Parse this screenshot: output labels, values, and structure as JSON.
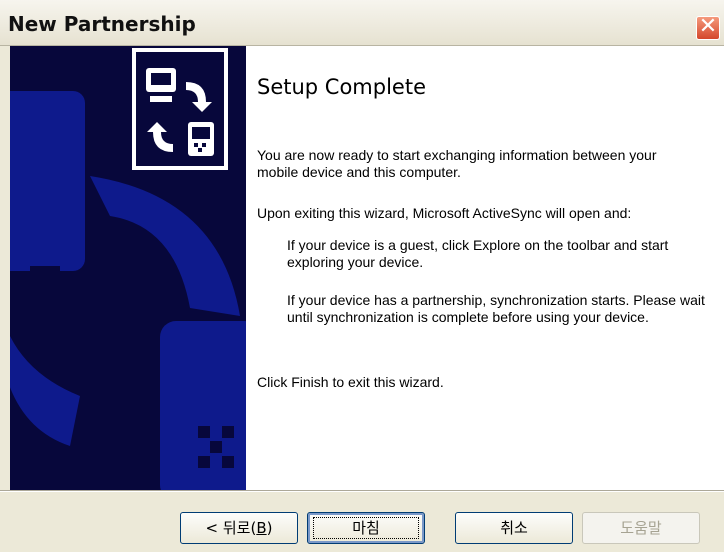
{
  "window": {
    "title": "New Partnership",
    "close_glyph": "✕"
  },
  "content": {
    "heading": "Setup Complete",
    "paragraphs": [
      "You are now ready to start exchanging information between your mobile device and this computer.",
      "Upon exiting this wizard, Microsoft ActiveSync will open and:",
      "If your device is a guest, click Explore on the toolbar and start exploring your device.",
      "If your device has a partnership, synchronization starts. Please wait until synchronization is complete before using your device.",
      "Click Finish to exit this wizard."
    ]
  },
  "buttons": {
    "back_prefix": "< 뒤로(",
    "back_key": "B",
    "back_suffix": ")",
    "finish": "마침",
    "cancel": "취소",
    "help": "도움말"
  },
  "icons": [
    "sync-icon",
    "computer-icon",
    "device-icon",
    "close-icon"
  ],
  "colors": {
    "banner_bg": "#07073b",
    "banner_shape": "#0e1a8c",
    "title_close": "#d4462b"
  }
}
